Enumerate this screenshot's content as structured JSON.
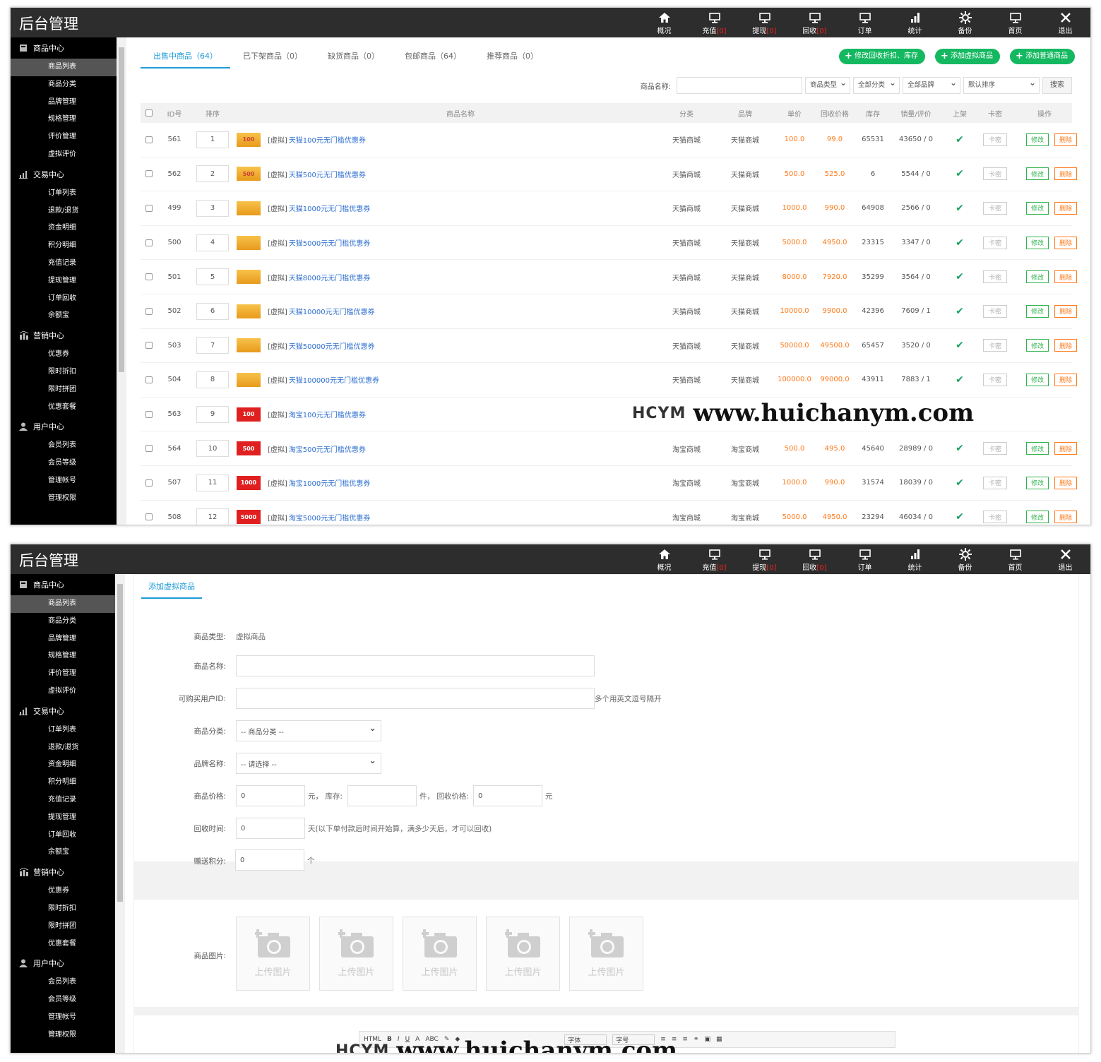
{
  "app": {
    "title": "后台管理"
  },
  "nav": [
    {
      "label": "概况",
      "badge": "",
      "icon": "home-icon"
    },
    {
      "label": "充值",
      "badge": "[0]",
      "icon": "monitor-icon"
    },
    {
      "label": "提现",
      "badge": "[0]",
      "icon": "monitor-icon"
    },
    {
      "label": "回收",
      "badge": "[0]",
      "icon": "monitor-icon"
    },
    {
      "label": "订单",
      "badge": "",
      "icon": "monitor-icon"
    },
    {
      "label": "统计",
      "badge": "",
      "icon": "bar-chart-icon"
    },
    {
      "label": "备份",
      "badge": "",
      "icon": "gear-icon"
    },
    {
      "label": "首页",
      "badge": "",
      "icon": "monitor-icon"
    },
    {
      "label": "退出",
      "badge": "",
      "icon": "close-icon"
    }
  ],
  "sidebar": {
    "groups": [
      {
        "label": "商品中心",
        "icon": "product-icon",
        "items": [
          "商品列表",
          "商品分类",
          "品牌管理",
          "规格管理",
          "评价管理",
          "虚拟评价"
        ]
      },
      {
        "label": "交易中心",
        "icon": "bar-chart-icon",
        "items": [
          "订单列表",
          "退款/退货",
          "资金明细",
          "积分明细",
          "充值记录",
          "提现管理",
          "订单回收",
          "余额宝"
        ]
      },
      {
        "label": "营销中心",
        "icon": "marketing-icon",
        "items": [
          "优惠券",
          "限时折扣",
          "限时拼团",
          "优惠套餐"
        ]
      },
      {
        "label": "用户中心",
        "icon": "user-icon",
        "items": [
          "会员列表",
          "会员等级",
          "管理帐号",
          "管理权限"
        ]
      }
    ]
  },
  "list": {
    "tabs": [
      "出售中商品（64）",
      "已下架商品（0）",
      "缺货商品（0）",
      "包邮商品（64）",
      "推荐商品（0）"
    ],
    "actions": [
      "修改回收折扣、库存",
      "添加虚拟商品",
      "添加普通商品"
    ],
    "filter": {
      "name_label": "商品名称:",
      "type": "商品类型",
      "category": "全部分类",
      "brand": "全部品牌",
      "sort": "默认排序",
      "search": "搜索"
    },
    "columns": [
      "ID号",
      "排序",
      "商品名称",
      "分类",
      "品牌",
      "单价",
      "回收价格",
      "库存",
      "销量/评价",
      "上架",
      "卡密",
      "操作"
    ],
    "rows": [
      {
        "id": "561",
        "sort": "1",
        "thumb": "100",
        "kind": "tm",
        "tag": "[虚拟]",
        "name": "天猫100元无门槛优惠券",
        "cat": "天猫商城",
        "brand": "天猫商城",
        "price": "100.0",
        "recycle": "99.0",
        "stock": "65531",
        "sales": "43650 / 0"
      },
      {
        "id": "562",
        "sort": "2",
        "thumb": "500",
        "kind": "tm",
        "tag": "[虚拟]",
        "name": "天猫500元无门槛优惠券",
        "cat": "天猫商城",
        "brand": "天猫商城",
        "price": "500.0",
        "recycle": "525.0",
        "stock": "6",
        "sales": "5544 / 0"
      },
      {
        "id": "499",
        "sort": "3",
        "thumb": "",
        "kind": "tm",
        "tag": "[虚拟]",
        "name": "天猫1000元无门槛优惠券",
        "cat": "天猫商城",
        "brand": "天猫商城",
        "price": "1000.0",
        "recycle": "990.0",
        "stock": "64908",
        "sales": "2566 / 0"
      },
      {
        "id": "500",
        "sort": "4",
        "thumb": "",
        "kind": "tm",
        "tag": "[虚拟]",
        "name": "天猫5000元无门槛优惠券",
        "cat": "天猫商城",
        "brand": "天猫商城",
        "price": "5000.0",
        "recycle": "4950.0",
        "stock": "23315",
        "sales": "3347 / 0"
      },
      {
        "id": "501",
        "sort": "5",
        "thumb": "",
        "kind": "tm",
        "tag": "[虚拟]",
        "name": "天猫8000元无门槛优惠券",
        "cat": "天猫商城",
        "brand": "天猫商城",
        "price": "8000.0",
        "recycle": "7920.0",
        "stock": "35299",
        "sales": "3564 / 0"
      },
      {
        "id": "502",
        "sort": "6",
        "thumb": "",
        "kind": "tm",
        "tag": "[虚拟]",
        "name": "天猫10000元无门槛优惠券",
        "cat": "天猫商城",
        "brand": "天猫商城",
        "price": "10000.0",
        "recycle": "9900.0",
        "stock": "42396",
        "sales": "7609 / 1"
      },
      {
        "id": "503",
        "sort": "7",
        "thumb": "",
        "kind": "tm",
        "tag": "[虚拟]",
        "name": "天猫50000元无门槛优惠券",
        "cat": "天猫商城",
        "brand": "天猫商城",
        "price": "50000.0",
        "recycle": "49500.0",
        "stock": "65457",
        "sales": "3520 / 0"
      },
      {
        "id": "504",
        "sort": "8",
        "thumb": "",
        "kind": "tm",
        "tag": "[虚拟]",
        "name": "天猫100000元无门槛优惠券",
        "cat": "天猫商城",
        "brand": "天猫商城",
        "price": "100000.0",
        "recycle": "99000.0",
        "stock": "43911",
        "sales": "7883 / 1"
      },
      {
        "id": "563",
        "sort": "9",
        "thumb": "100",
        "kind": "tb",
        "tag": "[虚拟]",
        "name": "淘宝100元无门槛优惠券",
        "cat": "",
        "brand": "",
        "price": "",
        "recycle": "",
        "stock": "",
        "sales": ""
      },
      {
        "id": "564",
        "sort": "10",
        "thumb": "500",
        "kind": "tb",
        "tag": "[虚拟]",
        "name": "淘宝500元无门槛优惠券",
        "cat": "淘宝商城",
        "brand": "淘宝商城",
        "price": "500.0",
        "recycle": "495.0",
        "stock": "45640",
        "sales": "28989 / 0"
      },
      {
        "id": "507",
        "sort": "11",
        "thumb": "1000",
        "kind": "tb",
        "tag": "[虚拟]",
        "name": "淘宝1000元无门槛优惠券",
        "cat": "淘宝商城",
        "brand": "淘宝商城",
        "price": "1000.0",
        "recycle": "990.0",
        "stock": "31574",
        "sales": "18039 / 0"
      },
      {
        "id": "508",
        "sort": "12",
        "thumb": "5000",
        "kind": "tb",
        "tag": "[虚拟]",
        "name": "淘宝5000元无门槛优惠券",
        "cat": "淘宝商城",
        "brand": "淘宝商城",
        "price": "5000.0",
        "recycle": "4950.0",
        "stock": "23294",
        "sales": "46034 / 0"
      }
    ],
    "card_btn": "卡密",
    "edit_btn": "修改",
    "delete_btn": "删除"
  },
  "watermark": {
    "logo": "HCYM",
    "url": "www.huichanym.com"
  },
  "form": {
    "tab": "添加虚拟商品",
    "type_label": "商品类型:",
    "type_value": "虚拟商品",
    "name_label": "商品名称:",
    "buyer_label": "可购买用户ID:",
    "buyer_hint": "多个用英文逗号隔开",
    "category_label": "商品分类:",
    "category_value": "-- 商品分类 --",
    "brand_label": "品牌名称:",
    "brand_value": "-- 请选择 --",
    "price_label": "商品价格:",
    "price_value": "0",
    "price_unit": "元，  库存:",
    "stock_unit": "件，  回收价格:",
    "recycle_value": "0",
    "recycle_unit": "元",
    "time_label": "回收时间:",
    "time_value": "0",
    "time_hint": "天(以下单付款后时间开始算，满多少天后，才可以回收)",
    "points_label": "赠送积分:",
    "points_value": "0",
    "points_unit": "个",
    "image_label": "商品图片:",
    "upload_label": "上传图片",
    "editor_font": "字体",
    "editor_size": "字号"
  }
}
